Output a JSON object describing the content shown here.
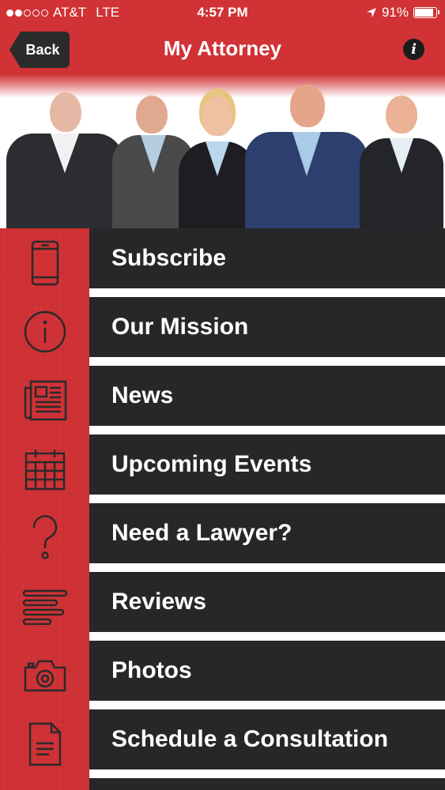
{
  "status": {
    "carrier": "AT&T",
    "network": "LTE",
    "time": "4:57 PM",
    "battery": "91%",
    "battery_level": 0.91
  },
  "nav": {
    "back_label": "Back",
    "title": "My Attorney",
    "info_label": "i"
  },
  "colors": {
    "brand_red": "#d03236",
    "menu_bg": "#272727",
    "icon_stroke": "#2a2a2a"
  },
  "menu": [
    {
      "label": "Subscribe",
      "icon": "smartphone-icon"
    },
    {
      "label": "Our Mission",
      "icon": "info-circle-icon"
    },
    {
      "label": "News",
      "icon": "newspaper-icon"
    },
    {
      "label": "Upcoming Events",
      "icon": "calendar-icon"
    },
    {
      "label": "Need a Lawyer?",
      "icon": "question-mark-icon"
    },
    {
      "label": "Reviews",
      "icon": "text-lines-icon"
    },
    {
      "label": "Photos",
      "icon": "camera-icon"
    },
    {
      "label": "Schedule a Consultation",
      "icon": "document-icon"
    }
  ]
}
